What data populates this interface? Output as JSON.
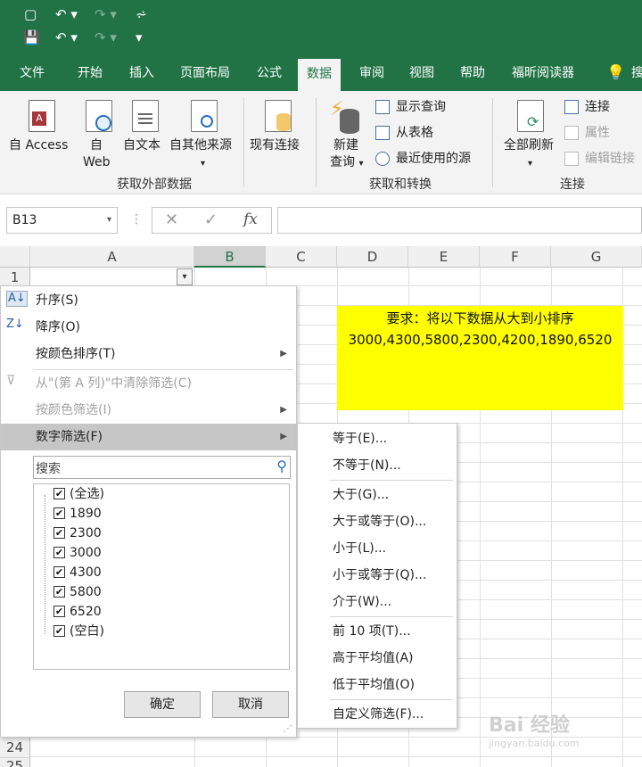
{
  "qat": {
    "row1": [
      "▢",
      "↶ ▾",
      "↷ ▾",
      "⩫"
    ],
    "row2": [
      "💾",
      "↶ ▾",
      "↷ ▾",
      "▾"
    ]
  },
  "tabs": [
    "文件",
    "开始",
    "插入",
    "页面布局",
    "公式",
    "数据",
    "审阅",
    "视图",
    "帮助",
    "福昕阅读器",
    "搜"
  ],
  "ribbon": {
    "access_label": "自 Access",
    "web_label1": "自",
    "web_label2": "Web",
    "text_label": "自文本",
    "other_label": "自其他来源",
    "existing_label": "现有连接",
    "group1": "获取外部数据",
    "newquery_label1": "新建",
    "newquery_label2": "查询",
    "show_query": "显示查询",
    "from_table": "从表格",
    "recent_sources": "最近使用的源",
    "group2": "获取和转换",
    "refresh_label": "全部刷新",
    "connections": "连接",
    "properties": "属性",
    "edit_links": "编辑链接",
    "group3": "连接"
  },
  "formula_bar": {
    "name_box": "B13",
    "cancel": "✕",
    "enter": "✓",
    "fx": "fx"
  },
  "grid": {
    "columns": [
      "A",
      "B",
      "C",
      "D",
      "E",
      "F",
      "G"
    ],
    "rows_visible": [
      "1",
      "24",
      "25"
    ]
  },
  "note": {
    "line1": "要求：将以下数据从大到小排序",
    "line2": "3000,4300,5800,2300,4200,1890,6520"
  },
  "filter_menu": {
    "sort_asc": "升序(S)",
    "sort_desc": "降序(O)",
    "sort_color": "按颜色排序(T)",
    "clear_filter": "从\"(第 A 列)\"中清除筛选(C)",
    "filter_color": "按颜色筛选(I)",
    "number_filter": "数字筛选(F)",
    "search_placeholder": "搜索",
    "list": [
      "(全选)",
      "1890",
      "2300",
      "3000",
      "4300",
      "5800",
      "6520",
      "(空白)"
    ],
    "ok": "确定",
    "cancel": "取消"
  },
  "submenu": {
    "items": [
      "等于(E)...",
      "不等于(N)...",
      "大于(G)...",
      "大于或等于(O)...",
      "小于(L)...",
      "小于或等于(Q)...",
      "介于(W)...",
      "前 10 项(T)...",
      "高于平均值(A)",
      "低于平均值(O)",
      "自定义筛选(F)..."
    ]
  },
  "watermark": {
    "line1": "Bai 经验",
    "line2": "jingyan.baidu.com"
  },
  "colors": {
    "excel_green": "#217346",
    "highlight_yellow": "#ffff00",
    "menu_highlight": "#c6c6c6"
  }
}
